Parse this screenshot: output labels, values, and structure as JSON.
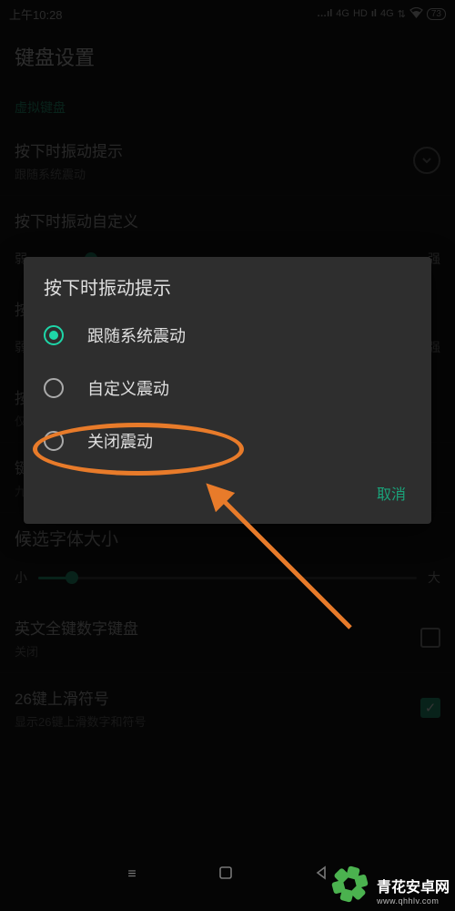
{
  "statusbar": {
    "time": "上午10:28",
    "net1": "4G",
    "hd": "HD",
    "net2": "4G",
    "battery": "73"
  },
  "page": {
    "title": "键盘设置"
  },
  "section_virtual": "虚拟键盘",
  "rows": {
    "vibrate": {
      "title": "按下时振动提示",
      "subtitle": "跟随系统震动"
    },
    "vibrate_custom": {
      "title": "按下时振动自定义"
    },
    "vibrate_slider": {
      "min": "弱",
      "max": "强"
    },
    "sound_custom_prefix": "按",
    "sound_slider": {
      "min": "弱",
      "max": "强"
    },
    "sound_row": {
      "title_prefix": "按",
      "subtitle_prefix": "仅"
    },
    "layout_row": {
      "title_prefix": "键",
      "subtitle_prefix": "九"
    },
    "candidate": {
      "title": "候选字体大小"
    },
    "candidate_slider": {
      "min": "小",
      "max": "大"
    },
    "en_digit": {
      "title": "英文全键数字键盘",
      "subtitle": "关闭"
    },
    "swipe26": {
      "title": "26键上滑符号",
      "subtitle": "显示26键上滑数字和符号"
    }
  },
  "dialog": {
    "title": "按下时振动提示",
    "options": [
      "跟随系统震动",
      "自定义震动",
      "关闭震动"
    ],
    "selected_index": 0,
    "cancel": "取消"
  },
  "watermark": {
    "name": "青花安卓网",
    "url": "www.qhhlv.com"
  }
}
